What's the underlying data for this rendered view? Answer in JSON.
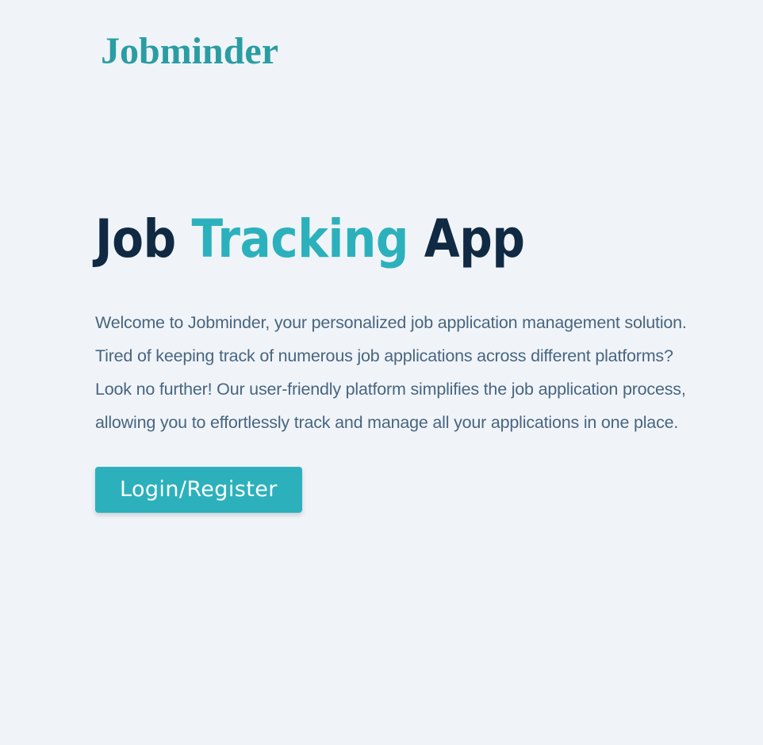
{
  "header": {
    "logo_text": "Jobminder"
  },
  "hero": {
    "title_part1": "Job ",
    "title_accent": "Tracking",
    "title_part2": " App",
    "description": "Welcome to Jobminder, your personalized job application management solution. Tired of keeping track of numerous job applications across different platforms? Look no further! Our user-friendly platform simplifies the job application process, allowing you to effortlessly track and manage all your applications in one place.",
    "cta_label": "Login/Register"
  },
  "colors": {
    "background": "#f0f4f8",
    "brand": "#2cb1bc",
    "logo": "#2a9da3",
    "heading": "#102a43",
    "body_text": "#486581"
  }
}
